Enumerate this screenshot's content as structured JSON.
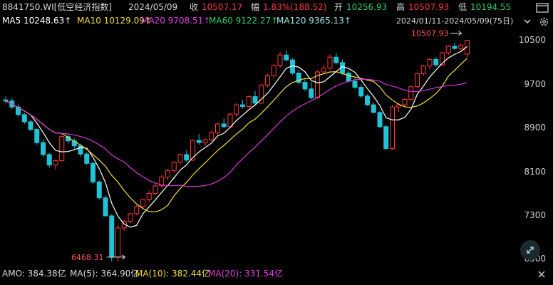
{
  "header": {
    "code_name": "8841750.WI[低空经济指数]",
    "date": "2024/05/09",
    "close_label": "收",
    "close_value": "10507.17",
    "change_label": "幅",
    "change_value": "1.83%(188.52)",
    "open_label": "开",
    "open_value": "10256.93",
    "high_label": "高",
    "high_value": "10507.93",
    "low_label": "低",
    "low_value": "10194.55"
  },
  "ma_line": {
    "ma5": "MA5 10248.63↑",
    "ma10": "MA10 10129.09↑",
    "ma20": "MA20 9708.51↑",
    "ma60": "MA60 9122.27↑",
    "ma120": "MA120 9365.13↑",
    "range": "2024/01/11-2024/05/09(75日)"
  },
  "y_axis": [
    "10500",
    "9700",
    "8900",
    "8100",
    "7300",
    "6500"
  ],
  "annotations": {
    "max_label": "10507.93",
    "min_label": "6468.31"
  },
  "volume_line": {
    "amo": "AMO: 384.38亿",
    "ma5": "MA(5): 364.90亿",
    "ma10": "MA(10): 382.44亿",
    "ma20": "MA(20): 331.54亿"
  },
  "colors": {
    "up": "#ff3b3b",
    "down": "#21c2d6",
    "ma5": "#ffffff",
    "ma10": "#f3df3a",
    "ma20": "#d63bd6",
    "ma60": "#2fbf2f",
    "ma120": "#9de8ea"
  },
  "icons": [
    "chevron-down-icon",
    "settings-icon",
    "expand-icon",
    "window-icon"
  ],
  "chart_data": {
    "type": "candlestick",
    "y_range": [
      6350,
      10750
    ],
    "y_ticks": [
      10500,
      9700,
      8900,
      8100,
      7300,
      6500
    ],
    "candles": [
      [
        9420,
        9480,
        9360,
        9400
      ],
      [
        9400,
        9450,
        9250,
        9290
      ],
      [
        9290,
        9350,
        9120,
        9150
      ],
      [
        9150,
        9180,
        8980,
        9020
      ],
      [
        9020,
        9060,
        8850,
        8880
      ],
      [
        8880,
        8900,
        8600,
        8640
      ],
      [
        8640,
        8700,
        8380,
        8420
      ],
      [
        8420,
        8450,
        8180,
        8230
      ],
      [
        8230,
        8330,
        8150,
        8310
      ],
      [
        8310,
        8780,
        8290,
        8750
      ],
      [
        8750,
        8800,
        8620,
        8670
      ],
      [
        8670,
        8720,
        8520,
        8580
      ],
      [
        8580,
        8620,
        8380,
        8430
      ],
      [
        8430,
        8460,
        8230,
        8260
      ],
      [
        8260,
        8300,
        7880,
        7920
      ],
      [
        7920,
        7950,
        7600,
        7630
      ],
      [
        7630,
        7680,
        7290,
        7300
      ],
      [
        7300,
        7330,
        6470,
        6550
      ],
      [
        6550,
        7140,
        6468,
        7080
      ],
      [
        7080,
        7240,
        7030,
        7200
      ],
      [
        7200,
        7360,
        7170,
        7340
      ],
      [
        7340,
        7500,
        7310,
        7470
      ],
      [
        7470,
        7620,
        7430,
        7600
      ],
      [
        7600,
        7760,
        7550,
        7710
      ],
      [
        7710,
        7880,
        7680,
        7850
      ],
      [
        7850,
        8040,
        7810,
        8010
      ],
      [
        8010,
        8160,
        7960,
        8130
      ],
      [
        8130,
        8300,
        8090,
        8280
      ],
      [
        8280,
        8440,
        8240,
        8420
      ],
      [
        8420,
        8500,
        8290,
        8320
      ],
      [
        8320,
        8700,
        8300,
        8680
      ],
      [
        8680,
        8800,
        8600,
        8640
      ],
      [
        8640,
        8720,
        8580,
        8690
      ],
      [
        8690,
        8860,
        8660,
        8820
      ],
      [
        8820,
        9000,
        8780,
        8980
      ],
      [
        8980,
        9080,
        8900,
        8930
      ],
      [
        8930,
        9180,
        8910,
        9160
      ],
      [
        9160,
        9360,
        9120,
        9330
      ],
      [
        9330,
        9420,
        9260,
        9300
      ],
      [
        9300,
        9500,
        9270,
        9480
      ],
      [
        9480,
        9580,
        9330,
        9360
      ],
      [
        9360,
        9720,
        9340,
        9690
      ],
      [
        9690,
        9900,
        9650,
        9860
      ],
      [
        9860,
        10080,
        9820,
        10050
      ],
      [
        10050,
        10300,
        10000,
        10240
      ],
      [
        10240,
        10330,
        10120,
        10150
      ],
      [
        10150,
        10180,
        9880,
        9910
      ],
      [
        9910,
        9960,
        9700,
        9740
      ],
      [
        9740,
        9820,
        9580,
        9620
      ],
      [
        9620,
        9750,
        9430,
        9460
      ],
      [
        9460,
        9960,
        9440,
        9930
      ],
      [
        9930,
        10060,
        9880,
        10000
      ],
      [
        10000,
        10250,
        9970,
        10200
      ],
      [
        10200,
        10280,
        10070,
        10100
      ],
      [
        10100,
        10160,
        9880,
        9910
      ],
      [
        9910,
        9960,
        9730,
        9760
      ],
      [
        9760,
        9820,
        9620,
        9650
      ],
      [
        9650,
        9700,
        9450,
        9490
      ],
      [
        9490,
        9520,
        9310,
        9330
      ],
      [
        9330,
        9380,
        9170,
        9190
      ],
      [
        9190,
        9220,
        8900,
        8930
      ],
      [
        8930,
        8960,
        8510,
        8530
      ],
      [
        8530,
        9320,
        8510,
        9290
      ],
      [
        9290,
        9370,
        9200,
        9330
      ],
      [
        9330,
        9450,
        9300,
        9430
      ],
      [
        9430,
        9680,
        9400,
        9660
      ],
      [
        9660,
        9920,
        9630,
        9900
      ],
      [
        9900,
        10060,
        9860,
        10040
      ],
      [
        10040,
        10180,
        9980,
        10160
      ],
      [
        10160,
        10200,
        10020,
        10060
      ],
      [
        10060,
        10300,
        10040,
        10280
      ],
      [
        10280,
        10420,
        10240,
        10400
      ],
      [
        10400,
        10460,
        10330,
        10360
      ],
      [
        10360,
        10450,
        10300,
        10420
      ],
      [
        10256.93,
        10507.93,
        10194.55,
        10507.17
      ]
    ]
  }
}
